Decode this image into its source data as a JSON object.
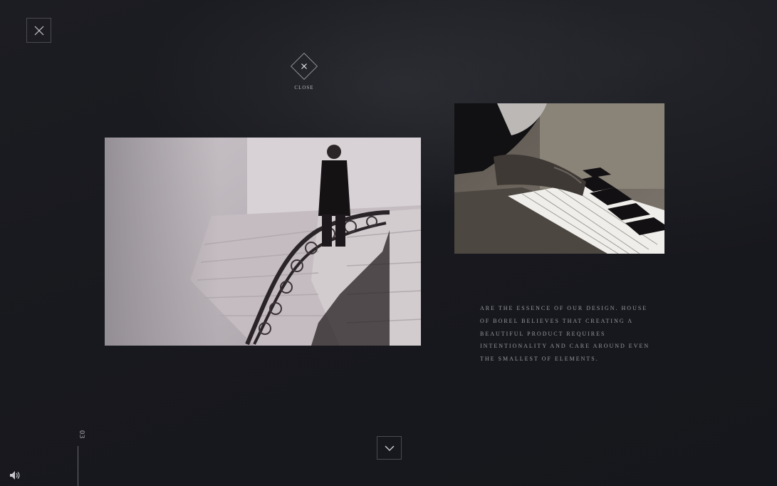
{
  "overlay": {
    "close_label": "CLOSE",
    "body_text": "ARE THE ESSENCE OF OUR DESIGN. HOUSE OF BOREL BELIEVES THAT CREATING A BEAUTIFUL PRODUCT REQUIRES INTENTIONALITY AND CARE AROUND EVEN THE SMALLEST OF ELEMENTS.",
    "slide_number": "03"
  },
  "icons": {
    "corner_close": "close-icon",
    "center_close": "close-icon",
    "next": "chevron-down-icon",
    "sound": "speaker-icon"
  },
  "colors": {
    "background": "#17181d",
    "text": "#9a9ba2",
    "border": "#4a4b52"
  }
}
